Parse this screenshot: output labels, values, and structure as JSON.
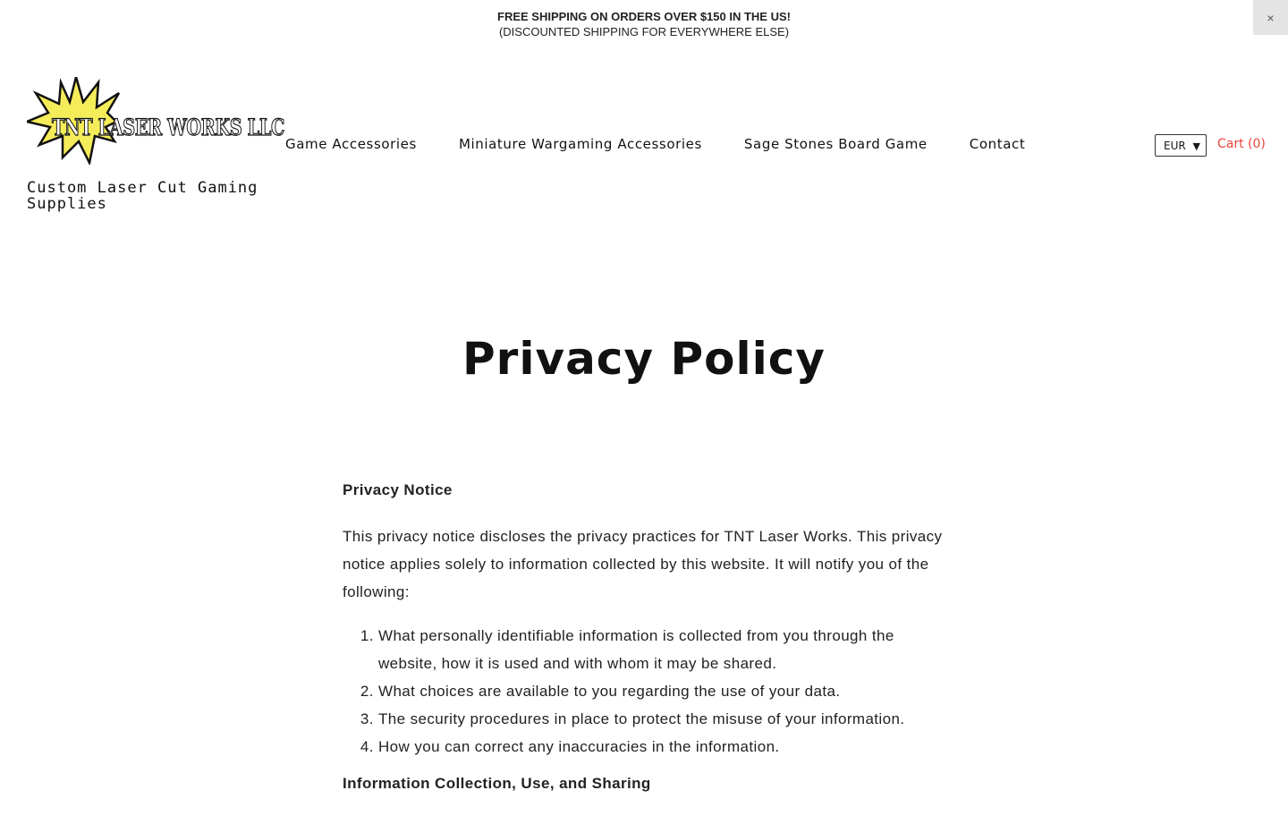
{
  "announcement": {
    "line1": "FREE SHIPPING ON ORDERS OVER $150 IN THE US!",
    "line2": "(DISCOUNTED SHIPPING FOR EVERYWHERE ELSE)",
    "close_label": "×"
  },
  "header": {
    "logo_text": "TNT LASER WORKS LLC",
    "tagline": "Custom Laser Cut Gaming Supplies",
    "nav": [
      {
        "label": "Game Accessories"
      },
      {
        "label": "Miniature Wargaming Accessories"
      },
      {
        "label": "Sage Stones Board Game"
      },
      {
        "label": "Contact"
      }
    ],
    "currency": "EUR",
    "cart_label": "Cart (0)"
  },
  "page": {
    "title": "Privacy Policy",
    "sections": {
      "privacy_notice_heading": "Privacy Notice",
      "intro": "This privacy notice discloses the privacy practices for TNT Laser Works. This privacy notice applies solely to information collected by this website. It will notify you of the following:",
      "list": [
        "What personally identifiable information is collected from you through the website, how it is used and with whom it may be shared.",
        "What choices are available to you regarding the use of your data.",
        "The security procedures in place to protect the misuse of your information.",
        "How you can correct any inaccuracies in the information."
      ],
      "info_heading": "Information Collection, Use, and Sharing"
    }
  },
  "colors": {
    "accent": "#e8453c",
    "logo_star": "#f5ec5a",
    "text": "#111111"
  }
}
